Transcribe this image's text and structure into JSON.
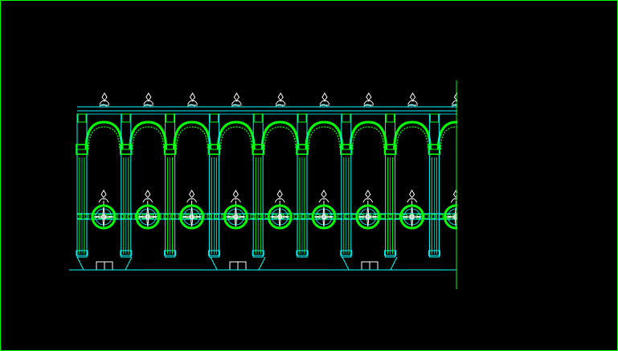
{
  "viewport": {
    "background": "#000000",
    "frame_color": "#00ff00"
  },
  "drawing": {
    "subject": "ornamental-fence-elevation",
    "line_color_primary": "#00ffff",
    "line_color_accent": "#00ff00",
    "line_color_detail": "#ffffff",
    "post_count": 9,
    "bay_count": 8,
    "finial_count": 9,
    "medallion_count": 9,
    "footing_count": 3,
    "crop_line_color": "#00ff00"
  }
}
